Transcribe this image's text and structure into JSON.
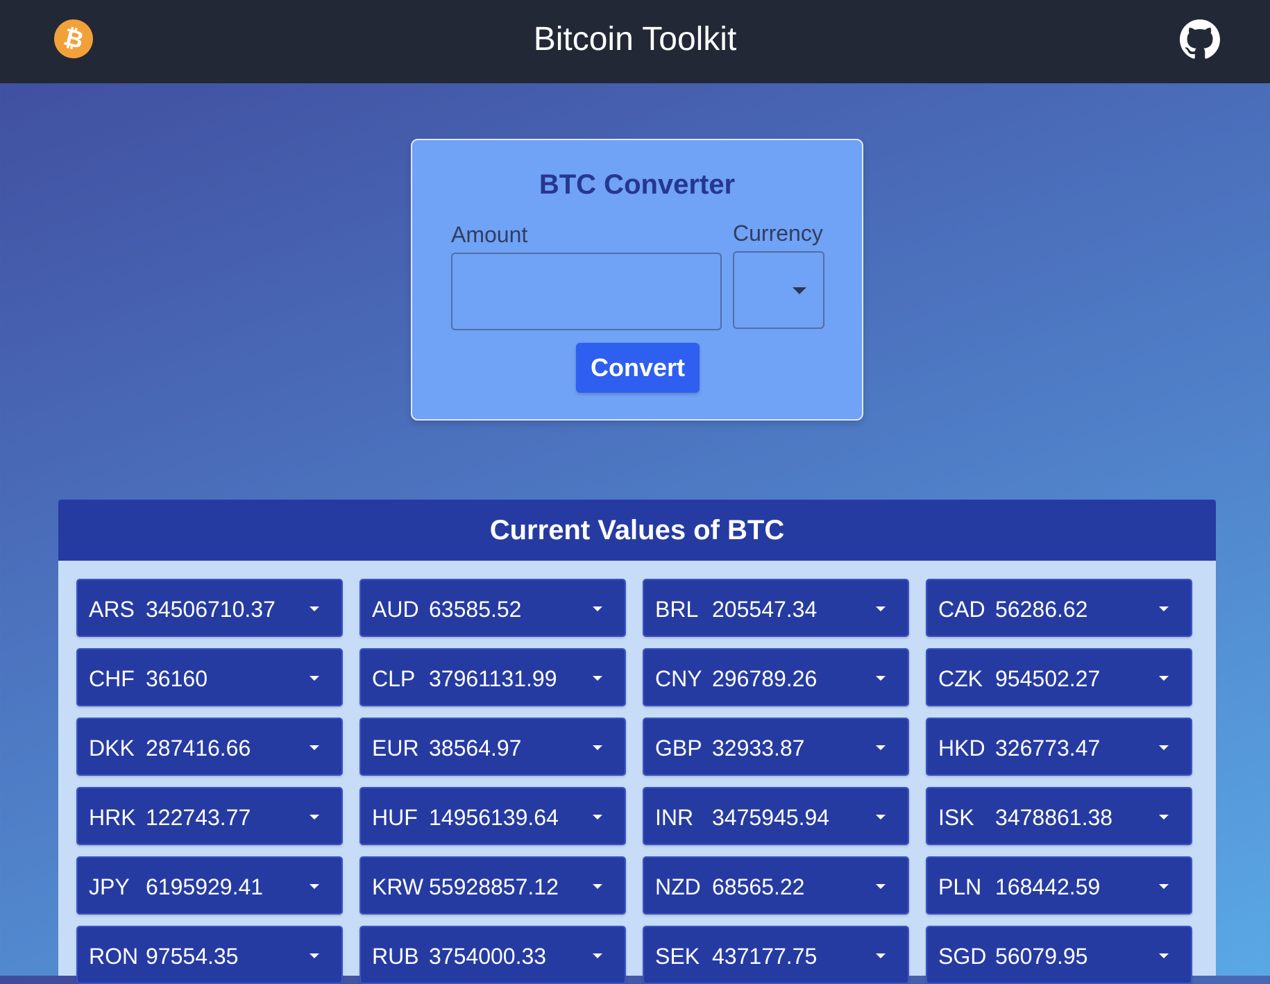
{
  "header": {
    "title": "Bitcoin Toolkit",
    "logo_glyph": "₿",
    "logo_icon": "bitcoin-icon",
    "github_icon": "github-icon"
  },
  "converter": {
    "title": "BTC Converter",
    "amount_label": "Amount",
    "amount_value": "",
    "currency_label": "Currency",
    "currency_value": "",
    "convert_label": "Convert"
  },
  "values": {
    "title": "Current Values of BTC",
    "rates": [
      {
        "code": "ARS",
        "value": "34506710.37"
      },
      {
        "code": "AUD",
        "value": "63585.52"
      },
      {
        "code": "BRL",
        "value": "205547.34"
      },
      {
        "code": "CAD",
        "value": "56286.62"
      },
      {
        "code": "CHF",
        "value": "36160"
      },
      {
        "code": "CLP",
        "value": "37961131.99"
      },
      {
        "code": "CNY",
        "value": "296789.26"
      },
      {
        "code": "CZK",
        "value": "954502.27"
      },
      {
        "code": "DKK",
        "value": "287416.66"
      },
      {
        "code": "EUR",
        "value": "38564.97"
      },
      {
        "code": "GBP",
        "value": "32933.87"
      },
      {
        "code": "HKD",
        "value": "326773.47"
      },
      {
        "code": "HRK",
        "value": "122743.77"
      },
      {
        "code": "HUF",
        "value": "14956139.64"
      },
      {
        "code": "INR",
        "value": "3475945.94"
      },
      {
        "code": "ISK",
        "value": "3478861.38"
      },
      {
        "code": "JPY",
        "value": "6195929.41"
      },
      {
        "code": "KRW",
        "value": "55928857.12"
      },
      {
        "code": "NZD",
        "value": "68565.22"
      },
      {
        "code": "PLN",
        "value": "168442.59"
      },
      {
        "code": "RON",
        "value": "97554.35"
      },
      {
        "code": "RUB",
        "value": "3754000.33"
      },
      {
        "code": "SEK",
        "value": "437177.75"
      },
      {
        "code": "SGD",
        "value": "56079.95"
      }
    ]
  },
  "colors": {
    "navbar": "#222836",
    "card": "#70a2f5",
    "accent": "#2e5ff0",
    "panel_header": "#263ba2",
    "logo": "#f2a13a"
  }
}
